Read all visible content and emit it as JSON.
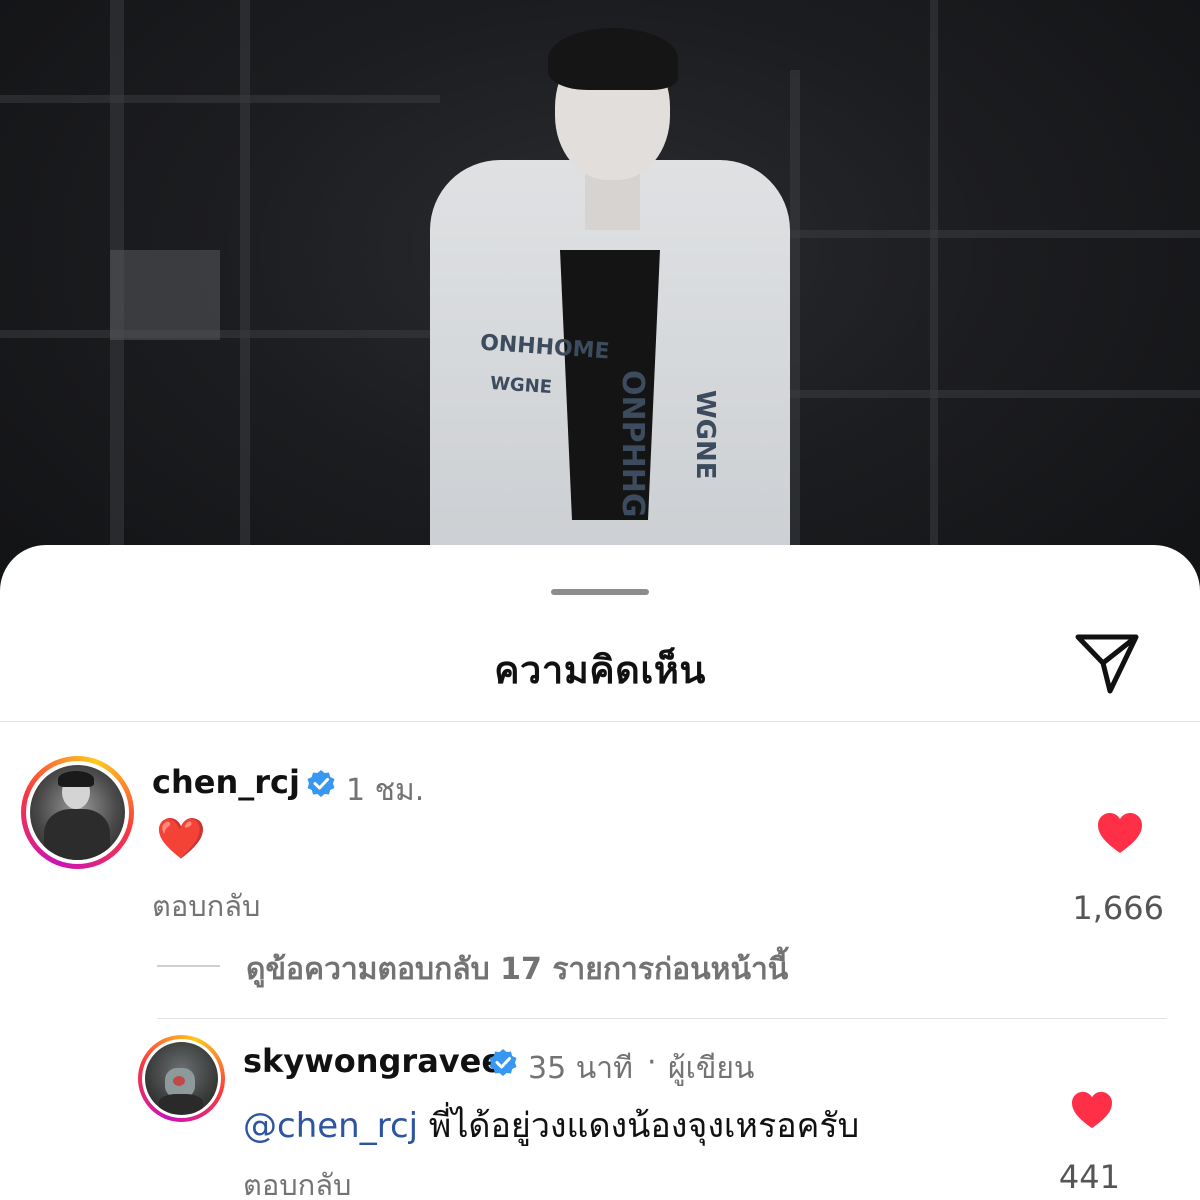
{
  "sheet": {
    "title": "ความคิดเห็น"
  },
  "comments": [
    {
      "username": "chen_rcj",
      "verified": true,
      "time": "1 ชม.",
      "text": "❤️",
      "reply_label": "ตอบกลับ",
      "likes": "1,666",
      "view_replies": "ดูข้อความตอบกลับ 17 รายการก่อนหน้านี้"
    },
    {
      "username": "skywongravee",
      "verified": true,
      "time": "35 นาที",
      "separator": "·",
      "author_tag": "ผู้เขียน",
      "mention": "@chen_rcj",
      "text": "พี่ได้อยู่วงแดงน้องจุงเหรอครับ",
      "reply_label": "ตอบกลับ",
      "likes": "441"
    }
  ],
  "colors": {
    "like_red": "#ff2f47",
    "verified_blue": "#3897f0",
    "mention_blue": "#2d55a0",
    "secondary_text": "#737373"
  },
  "icons": {
    "share": "paper-plane-icon",
    "like": "heart-icon",
    "verified": "verified-badge-icon"
  }
}
